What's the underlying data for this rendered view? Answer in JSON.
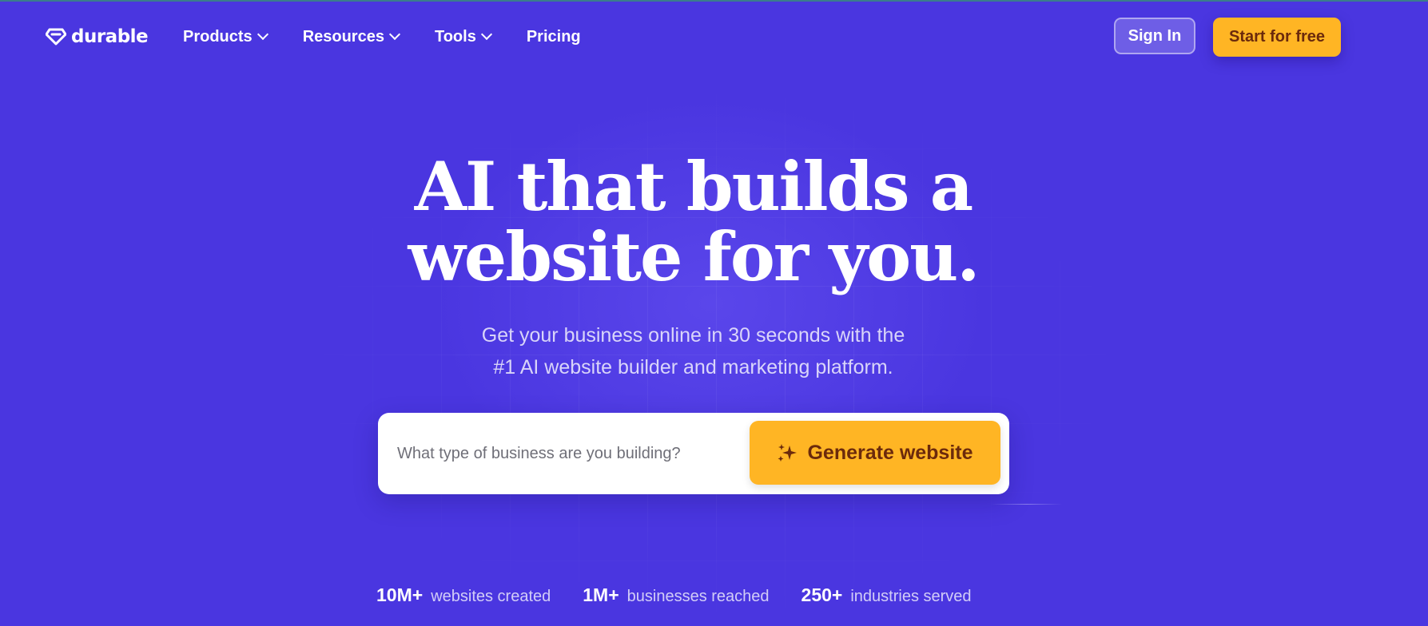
{
  "brand": {
    "name": "durable",
    "accent": "#4a36e0",
    "cta_color": "#ffb524",
    "cta_text_color": "#6b2a0c"
  },
  "nav": {
    "items": [
      {
        "label": "Products",
        "has_dropdown": true
      },
      {
        "label": "Resources",
        "has_dropdown": true
      },
      {
        "label": "Tools",
        "has_dropdown": true
      },
      {
        "label": "Pricing",
        "has_dropdown": false
      }
    ],
    "sign_in": "Sign In",
    "start": "Start for free"
  },
  "hero": {
    "title_line1": "AI that builds a",
    "title_line2": "website for you.",
    "subtitle_line1": "Get your business online in 30 seconds with the",
    "subtitle_line2": "#1 AI website builder and marketing platform."
  },
  "search": {
    "placeholder": "What type of business are you building?",
    "value": "",
    "button_label": "Generate website",
    "button_icon": "sparkle-icon"
  },
  "stats": [
    {
      "value": "10M+",
      "label": "websites created"
    },
    {
      "value": "1M+",
      "label": "businesses reached"
    },
    {
      "value": "250+",
      "label": "industries served"
    }
  ]
}
